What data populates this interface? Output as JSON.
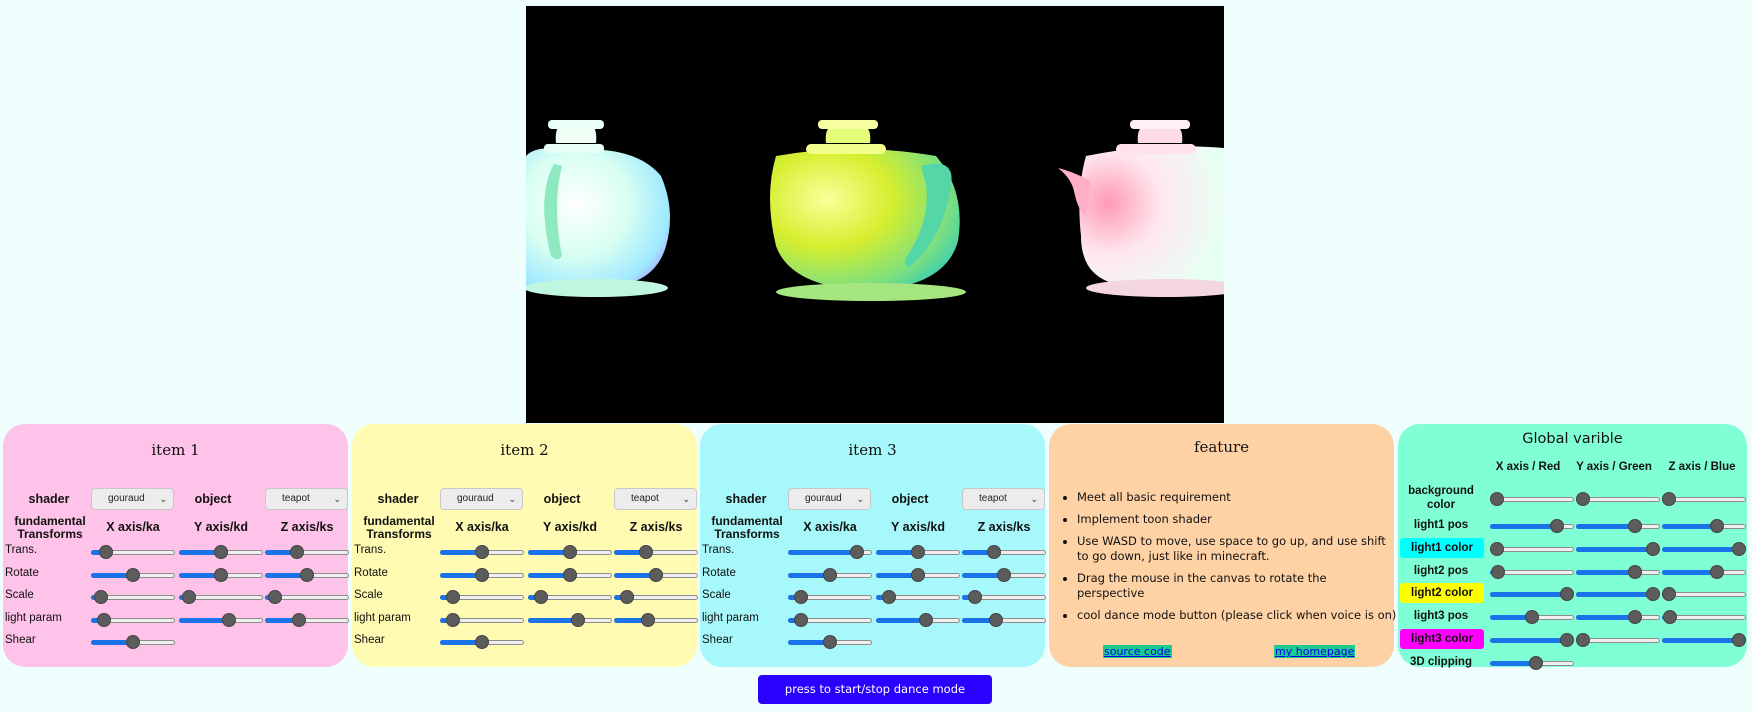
{
  "items": [
    {
      "title": "item 1",
      "shader_label": "shader",
      "shader_value": "gouraud",
      "object_label": "object",
      "object_value": "teapot",
      "transforms_label": "fundamental Transforms",
      "col_x": "X axis/ka",
      "col_y": "Y axis/kd",
      "col_z": "Z axis/ks",
      "rows": [
        {
          "label": "Trans.",
          "values": [
            0.18,
            0.5,
            0.38
          ]
        },
        {
          "label": "Rotate",
          "values": [
            0.5,
            0.5,
            0.5
          ]
        },
        {
          "label": "Scale",
          "values": [
            0.12,
            0.12,
            0.12
          ]
        },
        {
          "label": "light param",
          "values": [
            0.15,
            0.6,
            0.4
          ]
        },
        {
          "label": "Shear",
          "values": [
            0.5
          ]
        }
      ]
    },
    {
      "title": "item 2",
      "shader_label": "shader",
      "shader_value": "gouraud",
      "object_label": "object",
      "object_value": "teapot",
      "transforms_label": "fundamental Transforms",
      "col_x": "X axis/ka",
      "col_y": "Y axis/kd",
      "col_z": "Z axis/ks",
      "rows": [
        {
          "label": "Trans.",
          "values": [
            0.5,
            0.5,
            0.38
          ]
        },
        {
          "label": "Rotate",
          "values": [
            0.5,
            0.5,
            0.5
          ]
        },
        {
          "label": "Scale",
          "values": [
            0.15,
            0.15,
            0.15
          ]
        },
        {
          "label": "light param",
          "values": [
            0.15,
            0.6,
            0.4
          ]
        },
        {
          "label": "Shear",
          "values": [
            0.5
          ]
        }
      ]
    },
    {
      "title": "item 3",
      "shader_label": "shader",
      "shader_value": "gouraud",
      "object_label": "object",
      "object_value": "teapot",
      "transforms_label": "fundamental Transforms",
      "col_x": "X axis/ka",
      "col_y": "Y axis/kd",
      "col_z": "Z axis/ks",
      "rows": [
        {
          "label": "Trans.",
          "values": [
            0.82,
            0.5,
            0.38
          ]
        },
        {
          "label": "Rotate",
          "values": [
            0.5,
            0.5,
            0.5
          ]
        },
        {
          "label": "Scale",
          "values": [
            0.15,
            0.15,
            0.15
          ]
        },
        {
          "label": "light param",
          "values": [
            0.15,
            0.6,
            0.4
          ]
        },
        {
          "label": "Shear",
          "values": [
            0.5
          ]
        }
      ]
    }
  ],
  "feature": {
    "title": "feature",
    "bullets": [
      "Meet all basic requirement",
      "Implement toon shader",
      "Use WASD to move, use space to go up, and use shift to go down, just like in minecraft.",
      "Drag the mouse in the canvas to rotate the perspective",
      "cool dance mode button (please click when voice is on)"
    ],
    "source_link": "source code",
    "homepage_link": "my homepage"
  },
  "global": {
    "title": "Global varible",
    "col_x": "X axis / Red",
    "col_y": "Y axis / Green",
    "col_z": "Z axis / Blue",
    "rows": [
      {
        "label": "background color",
        "values": [
          0.0,
          0.0,
          0.0
        ]
      },
      {
        "label": "light1 pos",
        "values": [
          0.8,
          0.7,
          0.65
        ]
      },
      {
        "label": "light1 color",
        "values": [
          0.0,
          0.92,
          1.0
        ],
        "chip": "#00ffff"
      },
      {
        "label": "light2 pos",
        "values": [
          0.1,
          0.7,
          0.65
        ]
      },
      {
        "label": "light2 color",
        "values": [
          0.92,
          0.92,
          0.0
        ],
        "chip": "#ffff00"
      },
      {
        "label": "light3 pos",
        "values": [
          0.5,
          0.7,
          0.1
        ]
      },
      {
        "label": "light3 color",
        "values": [
          0.92,
          0.0,
          1.0
        ],
        "chip": "#ff00ff"
      },
      {
        "label": "3D clipping",
        "values": [
          0.55
        ]
      }
    ]
  },
  "dance_button": "press to start/stop dance mode",
  "colors": {
    "item1": "#ffc2e9",
    "item2": "#fffbb2",
    "item3": "#a6f8fb",
    "feature": "#ffd2a6",
    "global": "#80ffd6",
    "dance": "#2a00ff",
    "slider_fill": "#1a73e8"
  }
}
